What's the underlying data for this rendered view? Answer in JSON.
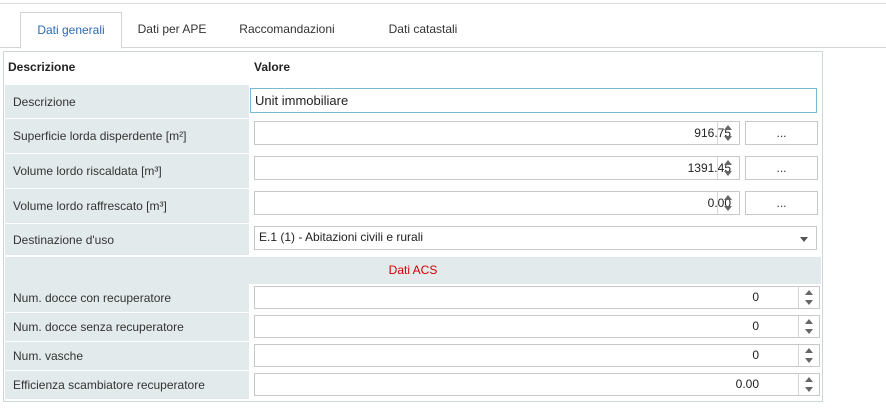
{
  "tabs": [
    {
      "label": "Dati generali",
      "active": true
    },
    {
      "label": "Dati per APE",
      "active": false
    },
    {
      "label": "Raccomandazioni",
      "active": false
    },
    {
      "label": "Dati catastali",
      "active": false
    }
  ],
  "grid": {
    "header_descrizione": "Descrizione",
    "header_valore": "Valore",
    "rows": {
      "descrizione": {
        "label": "Descrizione",
        "value": "Unit immobiliare"
      },
      "superficie": {
        "label": "Superficie lorda disperdente [m²]",
        "value": "916.75",
        "button": "..."
      },
      "volume_riscaldata": {
        "label": "Volume lordo riscaldata [m³]",
        "value": "1391.45",
        "button": "..."
      },
      "volume_raffrescato": {
        "label": "Volume lordo raffrescato [m³]",
        "value": "0.00",
        "button": "..."
      },
      "destinazione": {
        "label": "Destinazione d'uso",
        "value": "E.1 (1) - Abitazioni civili e rurali"
      }
    },
    "section_acs": "Dati ACS",
    "acs_rows": {
      "docce_con": {
        "label": "Num. docce con recuperatore",
        "value": "0"
      },
      "docce_senza": {
        "label": "Num. docce senza recuperatore",
        "value": "0"
      },
      "vasche": {
        "label": "Num. vasche",
        "value": "0"
      },
      "efficienza": {
        "label": "Efficienza scambiatore recuperatore",
        "value": "0.00"
      }
    }
  },
  "colors": {
    "active_tab_text": "#2a6bb5",
    "section_title": "#d00000",
    "label_background": "#e3eaeb",
    "focused_input_border": "#7ab8d6"
  },
  "icons": {
    "spinner_up": "triangle-up-icon",
    "spinner_down": "triangle-down-icon",
    "dropdown": "chevron-down-icon"
  }
}
